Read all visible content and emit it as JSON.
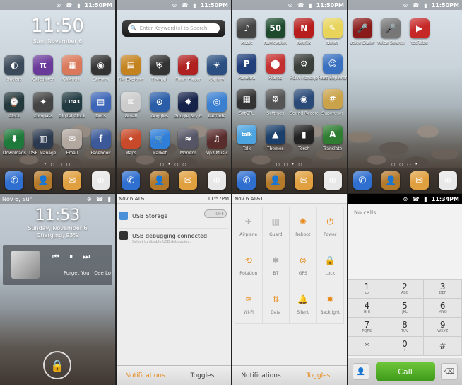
{
  "status": {
    "time": "11:50PM",
    "icons": "⊛ ☎ ▮"
  },
  "home": {
    "clock": "11:50",
    "date": "Sun, November 6"
  },
  "page1": [
    {
      "label": "Backup",
      "color": "#3b4a5a",
      "g": "◐"
    },
    {
      "label": "Calculator",
      "color": "#6a3a9a",
      "g": "π"
    },
    {
      "label": "Calendar",
      "color": "#d9785a",
      "g": "▦"
    },
    {
      "label": "Camera",
      "color": "#333",
      "g": "◉"
    },
    {
      "label": "Clock",
      "color": "#24393c",
      "g": "⌚"
    },
    {
      "label": "Compass",
      "color": "#444",
      "g": "✦"
    },
    {
      "label": "Digital Clock",
      "color": "#1f3a40",
      "g": "11:43"
    },
    {
      "label": "Docs",
      "color": "#3d66b8",
      "g": "▤"
    },
    {
      "label": "Downloads",
      "color": "#1e7a3a",
      "g": "⬇"
    },
    {
      "label": "DSR Manager",
      "color": "#2c3a50",
      "g": "▥"
    },
    {
      "label": "Email",
      "color": "#b3a8a0",
      "g": "✉"
    },
    {
      "label": "Facebook",
      "color": "#3b5998",
      "g": "f"
    }
  ],
  "page2": {
    "search_placeholder": "Enter Keyword(s) to Search",
    "apps": [
      {
        "label": "File Explorer",
        "color": "#c4831f",
        "g": "▤"
      },
      {
        "label": "Firewall",
        "color": "#333",
        "g": "⛨"
      },
      {
        "label": "Flash Player",
        "color": "#b02020",
        "g": "ƒ"
      },
      {
        "label": "Gallery",
        "color": "#2a4f80",
        "g": "☀"
      },
      {
        "label": "Gmail",
        "color": "#ccc",
        "g": "✉"
      },
      {
        "label": "Goggles",
        "color": "#2b5ea8",
        "g": "⊙"
      },
      {
        "label": "Google Sky M",
        "color": "#16224a",
        "g": "✸"
      },
      {
        "label": "Latitude",
        "color": "#3a7fd0",
        "g": "◎"
      },
      {
        "label": "Maps",
        "color": "#c84a2a",
        "g": "⌖"
      },
      {
        "label": "Market",
        "color": "#2f7ed8",
        "g": "🛒"
      },
      {
        "label": "Monitor",
        "color": "#556",
        "g": "≈"
      },
      {
        "label": "Mp3 Music",
        "color": "#5a2d2d",
        "g": "♫"
      }
    ]
  },
  "page3": [
    {
      "label": "Music",
      "color": "#444",
      "g": "♪"
    },
    {
      "label": "Navigation",
      "color": "#1d4a2d",
      "g": "50"
    },
    {
      "label": "Netflix",
      "color": "#b81d1d",
      "g": "N"
    },
    {
      "label": "Notes",
      "color": "#e8d45a",
      "g": "✎"
    },
    {
      "label": "Pandora",
      "color": "#1f3e7a",
      "g": "P"
    },
    {
      "label": "Places",
      "color": "#c43030",
      "g": "⬤"
    },
    {
      "label": "ROM Manager",
      "color": "#3a3f3a",
      "g": "⚙"
    },
    {
      "label": "Root Explorer",
      "color": "#3a70c0",
      "g": "☺"
    },
    {
      "label": "SetCPU",
      "color": "#333",
      "g": "▦"
    },
    {
      "label": "Settings",
      "color": "#555",
      "g": "⚙"
    },
    {
      "label": "Sound Recorder",
      "color": "#2a4a78",
      "g": "◉"
    },
    {
      "label": "Superuser",
      "color": "#c9a24a",
      "g": "#"
    },
    {
      "label": "Talk",
      "color": "#4ba3e0",
      "g": "talk"
    },
    {
      "label": "Themes",
      "color": "#1a3f6a",
      "g": "▲"
    },
    {
      "label": "Torch",
      "color": "#222",
      "g": "▮"
    },
    {
      "label": "Translate",
      "color": "#2e7d32",
      "g": "A"
    }
  ],
  "page4": [
    {
      "label": "Voice Dialer",
      "color": "#8a1a1a",
      "g": "🎤"
    },
    {
      "label": "Voice Search",
      "color": "#777",
      "g": "🎤"
    },
    {
      "label": "YouTube",
      "color": "#c62828",
      "g": "▶"
    }
  ],
  "dock": [
    {
      "name": "phone-icon",
      "color": "#2f6fd0",
      "g": "✆"
    },
    {
      "name": "contacts-icon",
      "color": "#b5792a",
      "g": "👤"
    },
    {
      "name": "messages-icon",
      "color": "#e0a040",
      "g": "✉"
    },
    {
      "name": "browser-icon",
      "color": "#e8e8e8",
      "g": "⊕"
    }
  ],
  "lock": {
    "status_left": "Nov 6, Sun",
    "clock": "11:53",
    "date": "Sunday, November 6",
    "charging": "Charging, 93%",
    "song": "Forget You",
    "artist": "Cee Lo"
  },
  "notif": {
    "left": "Nov 6  AT&T",
    "time": "11:57PM",
    "usb_storage": "USB Storage",
    "toggle": "OFF",
    "usb_debug": "USB debugging connected",
    "usb_debug_sub": "Select to disable USB debugging.",
    "tab_notifications": "Notifications",
    "tab_toggles": "Toggles"
  },
  "toggles": [
    {
      "label": "Airplane",
      "g": "✈",
      "on": false
    },
    {
      "label": "Guard",
      "g": "▥",
      "on": false
    },
    {
      "label": "Reboot",
      "g": "✺",
      "on": true
    },
    {
      "label": "Power",
      "g": "⏻",
      "on": true
    },
    {
      "label": "Rotation",
      "g": "⟲",
      "on": true
    },
    {
      "label": "BT",
      "g": "✱",
      "on": false
    },
    {
      "label": "GPS",
      "g": "⊚",
      "on": true
    },
    {
      "label": "Lock",
      "g": "🔒",
      "on": true
    },
    {
      "label": "Wi-Fi",
      "g": "≋",
      "on": true
    },
    {
      "label": "Data",
      "g": "⇅",
      "on": true
    },
    {
      "label": "Silent",
      "g": "🔔",
      "on": true
    },
    {
      "label": "Backlight",
      "g": "✹",
      "on": true
    }
  ],
  "dialer": {
    "time": "11:34PM",
    "no_calls": "No calls",
    "call": "Call",
    "keys": [
      {
        "d": "1",
        "s": "ꝏ"
      },
      {
        "d": "2",
        "s": "ABC"
      },
      {
        "d": "3",
        "s": "DEF"
      },
      {
        "d": "4",
        "s": "GHI"
      },
      {
        "d": "5",
        "s": "JKL"
      },
      {
        "d": "6",
        "s": "MNO"
      },
      {
        "d": "7",
        "s": "PQRS"
      },
      {
        "d": "8",
        "s": "TUV"
      },
      {
        "d": "9",
        "s": "WXYZ"
      },
      {
        "d": "*",
        "s": ""
      },
      {
        "d": "0",
        "s": "+"
      },
      {
        "d": "#",
        "s": ""
      }
    ]
  }
}
